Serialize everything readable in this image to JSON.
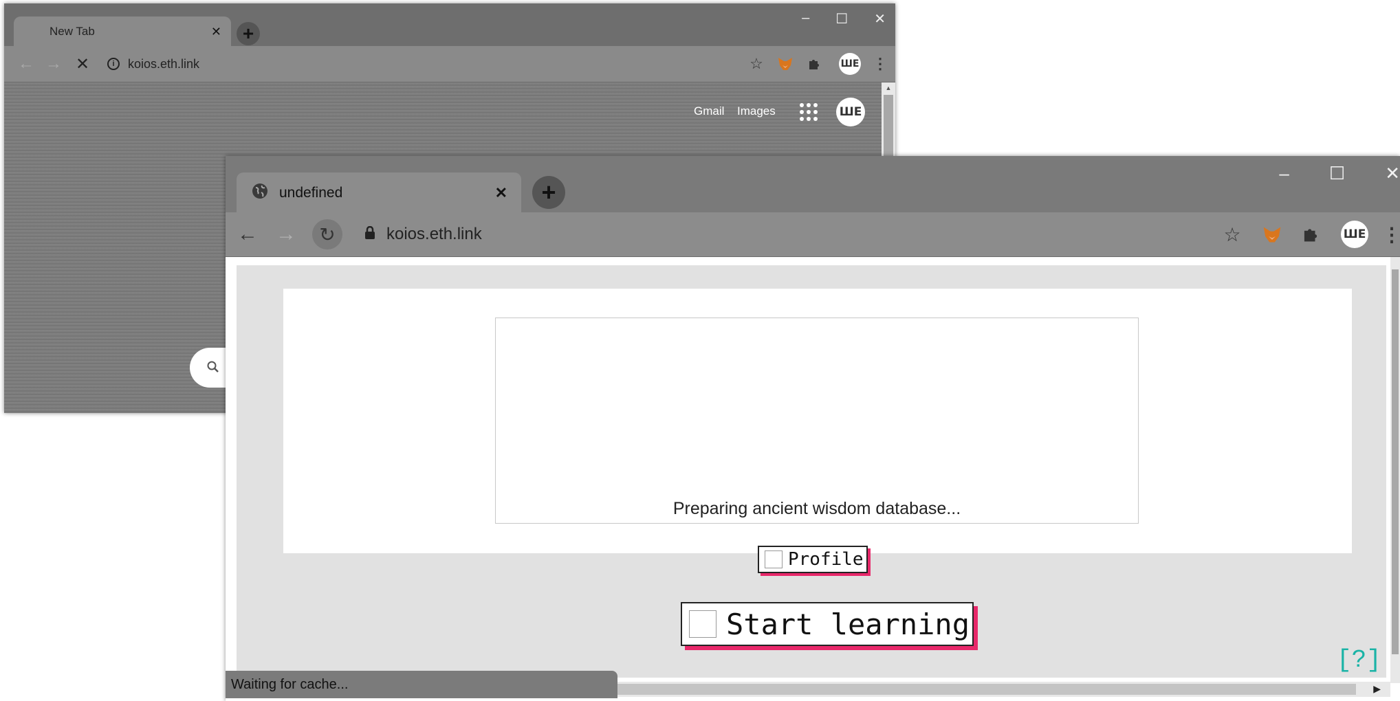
{
  "back_window": {
    "tab_title": "New Tab",
    "tab_close": "✕",
    "new_tab_symbol": "+",
    "url": "koios.eth.link",
    "reload_state": "stop",
    "controls": {
      "minimize": "–",
      "maximize": "☐",
      "close": "✕"
    },
    "ntp_links": {
      "gmail": "Gmail",
      "images": "Images"
    },
    "avatar_text": "ШE"
  },
  "front_window": {
    "tab_title": "undefined",
    "tab_close": "✕",
    "new_tab_symbol": "+",
    "url": "koios.eth.link",
    "controls": {
      "minimize": "–",
      "maximize": "☐",
      "close": "✕"
    },
    "avatar_text": "ШE",
    "page": {
      "loading_text": "Preparing ancient wisdom database...",
      "profile_label": "Profile",
      "start_label": "Start learning",
      "help_label": "[?]"
    },
    "status_text": "Waiting for cache..."
  },
  "colors": {
    "accent_pink": "#e8286a",
    "help_teal": "#1ab3a6",
    "page_bg": "#e1e1e1",
    "chrome_gray": "#7b7b7b"
  }
}
